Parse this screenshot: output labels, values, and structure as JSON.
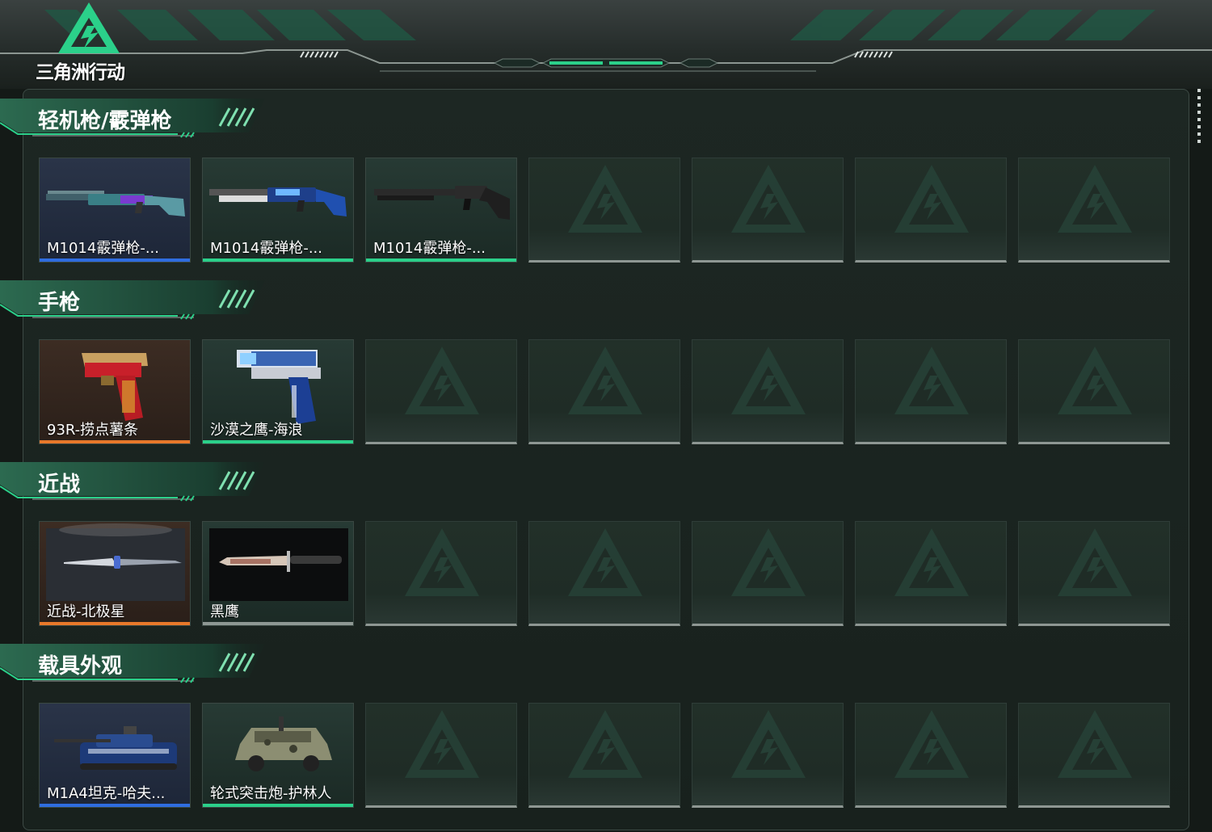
{
  "app": {
    "logo_text": "三角洲行动"
  },
  "colors": {
    "accent_green": "#2bd08a",
    "rarity_blue": "#2f6de0",
    "rarity_green": "#2bd08a",
    "rarity_orange": "#e8782a",
    "empty_bar": "#8e9793"
  },
  "sections": [
    {
      "title": "轻机枪/霰弹枪",
      "items": [
        {
          "name": "M1014霰弹枪-...",
          "rarity": "blue",
          "icon": "shotgun-purple"
        },
        {
          "name": "M1014霰弹枪-...",
          "rarity": "green",
          "icon": "shotgun-blue"
        },
        {
          "name": "M1014霰弹枪-...",
          "rarity": "green",
          "icon": "shotgun-black"
        }
      ]
    },
    {
      "title": "手枪",
      "items": [
        {
          "name": "93R-捞点薯条",
          "rarity": "orange",
          "icon": "pistol-red-gold"
        },
        {
          "name": "沙漠之鹰-海浪",
          "rarity": "green",
          "icon": "pistol-blue-wave"
        }
      ]
    },
    {
      "title": "近战",
      "items": [
        {
          "name": "近战-北极星",
          "rarity": "orange",
          "icon": "knife-silver"
        },
        {
          "name": "黑鹰",
          "rarity": "none",
          "icon": "knife-camo"
        }
      ]
    },
    {
      "title": "载具外观",
      "items": [
        {
          "name": "M1A4坦克-哈夫...",
          "rarity": "blue",
          "icon": "tank"
        },
        {
          "name": "轮式突击炮-护林人",
          "rarity": "green",
          "icon": "armored-car"
        }
      ]
    }
  ]
}
